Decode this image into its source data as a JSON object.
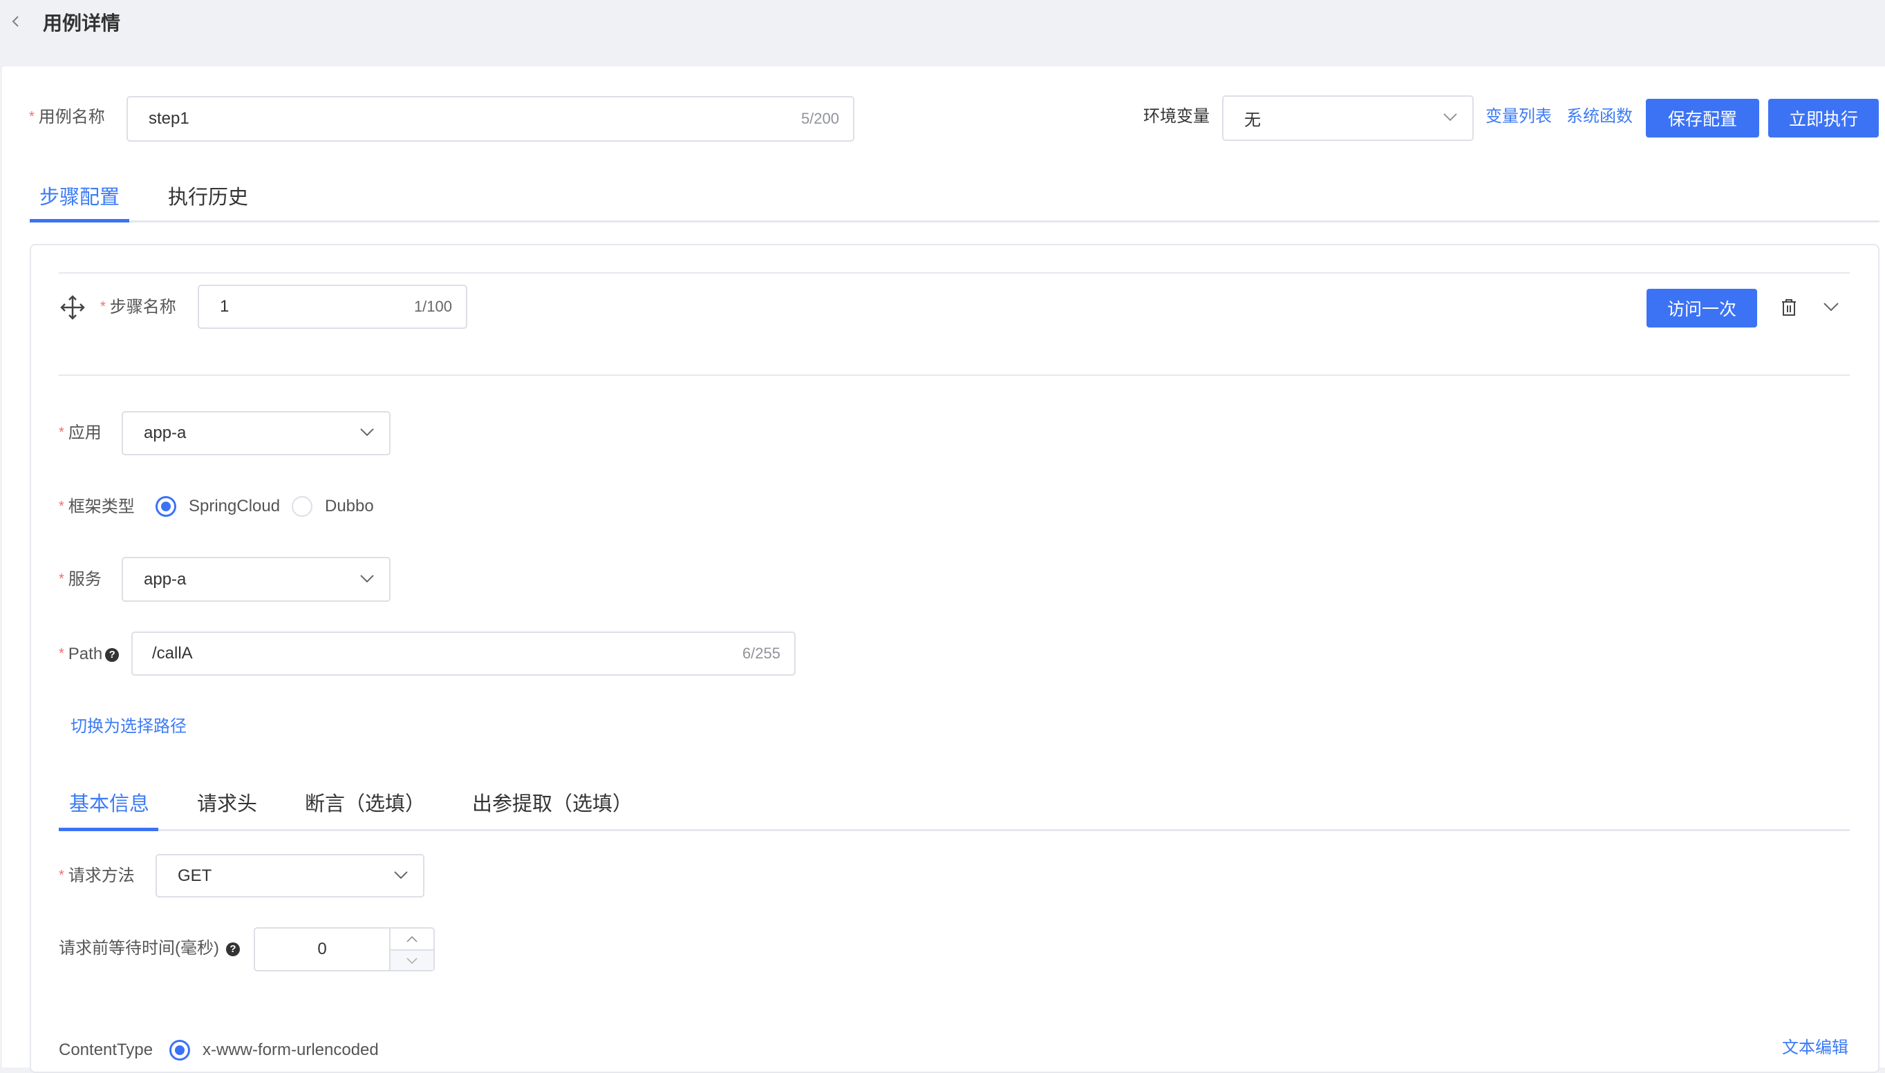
{
  "header": {
    "title": "用例详情",
    "back_icon": "chevron-left-icon"
  },
  "case": {
    "name_label": "用例名称",
    "name_value": "step1",
    "name_count": "5/200"
  },
  "toolbar": {
    "env_label": "环境变量",
    "env_value": "无",
    "var_list_link": "变量列表",
    "sys_func_link": "系统函数",
    "save_label": "保存配置",
    "execute_label": "立即执行"
  },
  "tabs": [
    {
      "label": "步骤配置",
      "active": true
    },
    {
      "label": "执行历史",
      "active": false
    }
  ],
  "step": {
    "drag_icon": "move-icon",
    "name_label": "步骤名称",
    "name_value": "1",
    "name_count": "1/100",
    "visit_once_label": "访问一次",
    "delete_icon": "trash-icon",
    "collapse_icon": "chevron-down-icon",
    "app_label": "应用",
    "app_value": "app-a",
    "framework_label": "框架类型",
    "framework_options": [
      {
        "label": "SpringCloud",
        "selected": true
      },
      {
        "label": "Dubbo",
        "selected": false
      }
    ],
    "service_label": "服务",
    "service_value": "app-a",
    "path_label": "Path",
    "path_value": "/callA",
    "path_count": "6/255",
    "switch_path_link": "切换为选择路径"
  },
  "sub_tabs": [
    {
      "label": "基本信息",
      "active": true
    },
    {
      "label": "请求头",
      "active": false
    },
    {
      "label": "断言（选填）",
      "active": false
    },
    {
      "label": "出参提取（选填）",
      "active": false
    }
  ],
  "basic": {
    "method_label": "请求方法",
    "method_value": "GET",
    "wait_label": "请求前等待时间(毫秒)",
    "wait_value": "0",
    "content_type_label": "ContentType",
    "content_type_option": "x-www-form-urlencoded",
    "text_edit_link": "文本编辑"
  },
  "colors": {
    "primary": "#3c73f5",
    "required": "#f56c6c",
    "header_bg": "#f0f1f5"
  }
}
